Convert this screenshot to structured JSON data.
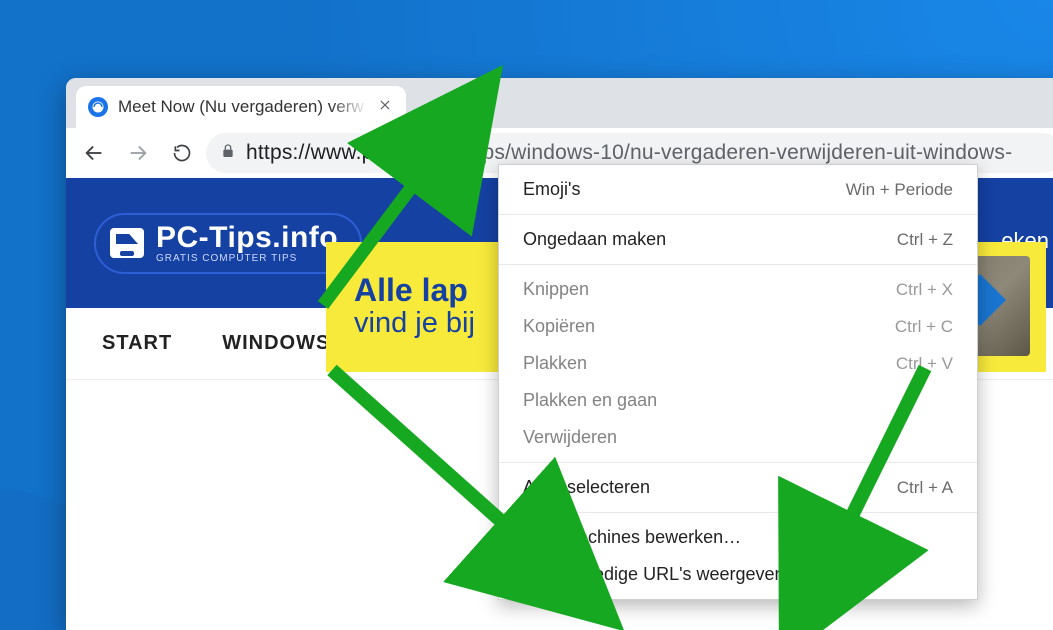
{
  "tab": {
    "title": "Meet Now (Nu vergaderen) verw"
  },
  "url": {
    "scheme": "https://",
    "host": "www.pc-tips.info",
    "path": "/tips/windows-10/nu-vergaderen-verwijderen-uit-windows-"
  },
  "site": {
    "logo_text": "PC-Tips.info",
    "logo_sub": "GRATIS COMPUTER TIPS",
    "header_link": "eken",
    "nav": {
      "start": "START",
      "windows": "WINDOWS TIPS",
      "plus": "+"
    }
  },
  "ad": {
    "headline": "Alle lap",
    "sub": "vind je bij"
  },
  "menu": {
    "emoji": {
      "label": "Emoji's",
      "shortcut": "Win + Periode"
    },
    "undo": {
      "label": "Ongedaan maken",
      "shortcut": "Ctrl + Z"
    },
    "cut": {
      "label": "Knippen",
      "shortcut": "Ctrl + X"
    },
    "copy": {
      "label": "Kopiëren",
      "shortcut": "Ctrl + C"
    },
    "paste": {
      "label": "Plakken",
      "shortcut": "Ctrl + V"
    },
    "pastego": {
      "label": "Plakken en gaan"
    },
    "delete": {
      "label": "Verwijderen"
    },
    "selectall": {
      "label": "Alles selecteren",
      "shortcut": "Ctrl + A"
    },
    "editsearch": {
      "label": "Zoekmachines bewerken…"
    },
    "showfullurl": {
      "label": "Altijd volledige URL's weergeven"
    }
  }
}
